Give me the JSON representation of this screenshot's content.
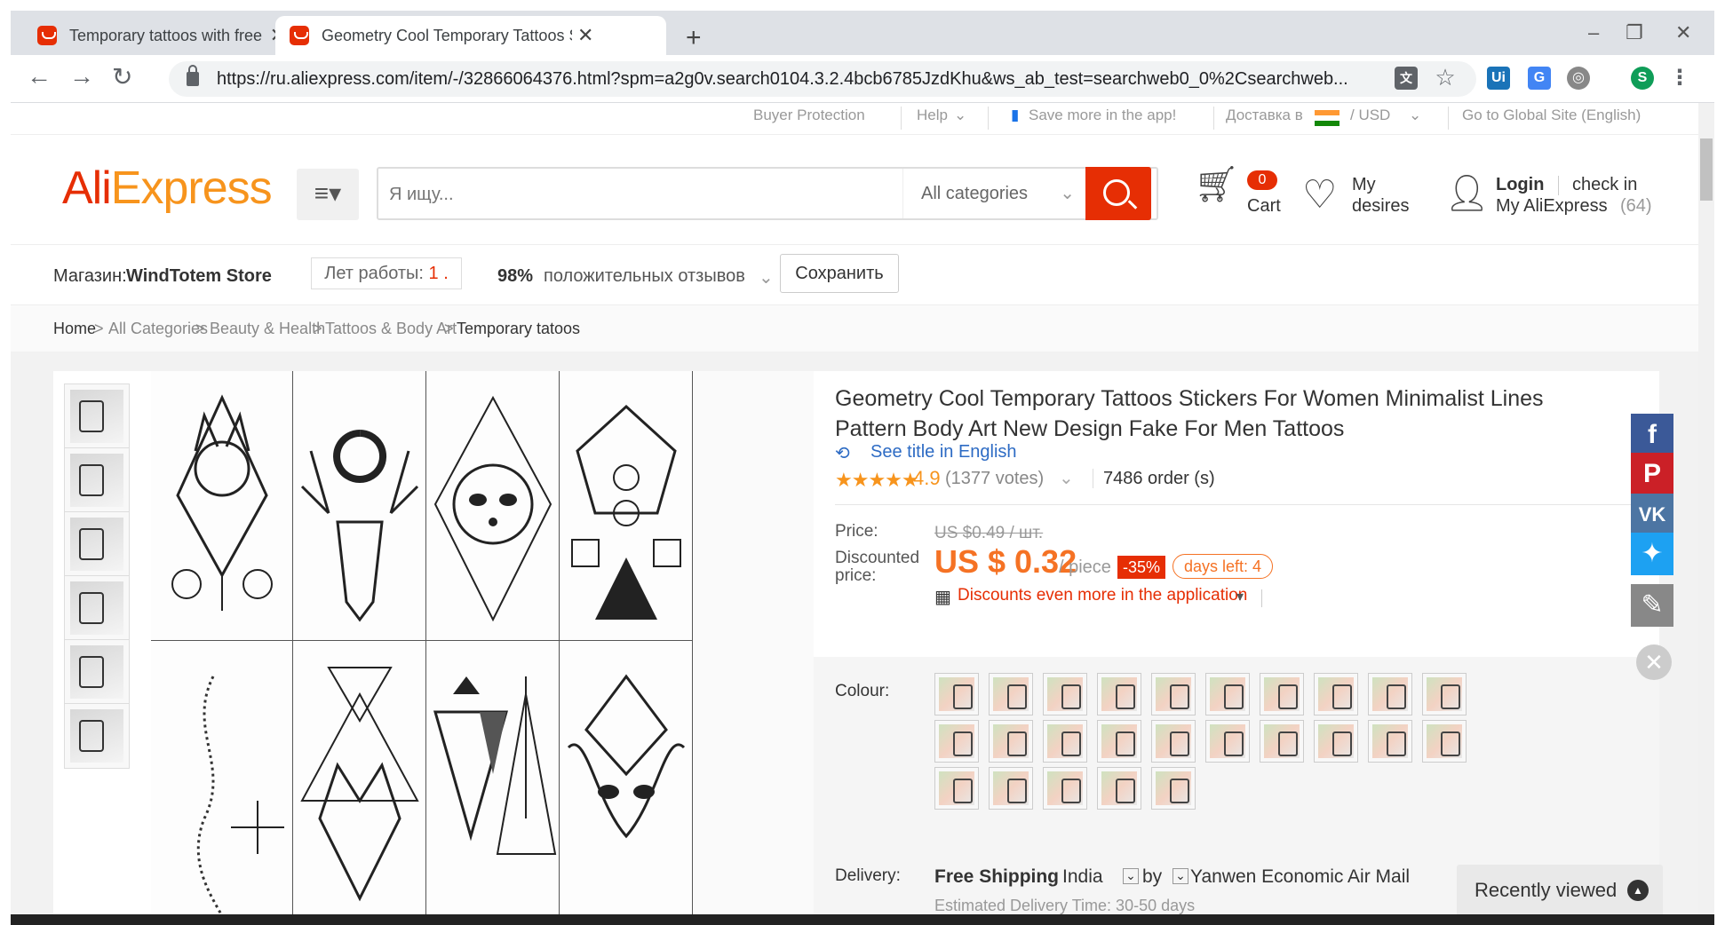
{
  "browser": {
    "tabs": [
      {
        "title": "Temporary tattoos with free shipping"
      },
      {
        "title": "Geometry Cool Temporary Tattoos Stickers"
      }
    ],
    "url": "https://ru.aliexpress.com/item/-/32866064376.html?spm=a2g0v.search0104.3.2.4bcb6785JzdKhu&ws_ab_test=searchweb0_0%2Csearchweb..."
  },
  "topstrip": {
    "buyer_protection": "Buyer Protection",
    "help": "Help",
    "save_app": "Save more in the app!",
    "delivery": "Доставка в",
    "currency": "/  USD",
    "global": "Go to Global Site (English)"
  },
  "header": {
    "logo_a": "Ali",
    "logo_b": "Express",
    "search_placeholder": "Я ищу...",
    "categories": "All categories",
    "cart_count": "0",
    "cart": "Cart",
    "wish_1": "My",
    "wish_2": "desires",
    "login": "Login",
    "checkin": "check in",
    "my_ali": "My AliExpress",
    "my_ali_count": "(64)"
  },
  "store": {
    "label": "Магазин:",
    "name": "WindTotem Store",
    "years_label": "Лет работы:",
    "years_value": "1 .",
    "positive_pct": "98%",
    "positive_text": "положительных отзывов",
    "save": "Сохранить"
  },
  "breadcrumbs": [
    "Home",
    ">",
    "All Categories",
    ">",
    "Beauty & Health",
    ">",
    "Tattoos & Body Art",
    ">",
    "Temporary tatoos"
  ],
  "product": {
    "title": "Geometry Cool Temporary Tattoos Stickers For Women Minimalist Lines Pattern Body Art New Design Fake For Men Tattoos",
    "see_title": "See title in English",
    "stars": "★★★★★",
    "rating": "4.9",
    "votes": "(1377 votes)",
    "orders": "7486 order (s)",
    "price_label": "Price:",
    "old_price": "US $0.49 / шт.",
    "disc_label_1": "Discounted",
    "disc_label_2": "price:",
    "price": "US $ 0.32",
    "per": "/ piece",
    "discount": "-35%",
    "days_left": "days left: 4",
    "app_discount": "Discounts even more in the application",
    "colour_label": "Colour:",
    "delivery_label": "Delivery:",
    "free_shipping": "Free Shipping",
    "country": "India",
    "by": "by",
    "carrier": "Yanwen Economic Air Mail",
    "est": "Estimated Delivery Time: 30-50 days"
  },
  "recently_viewed": "Recently viewed",
  "colors": {
    "accent": "#e62e04",
    "orange": "#f7941d",
    "link": "#2d6bc4"
  }
}
